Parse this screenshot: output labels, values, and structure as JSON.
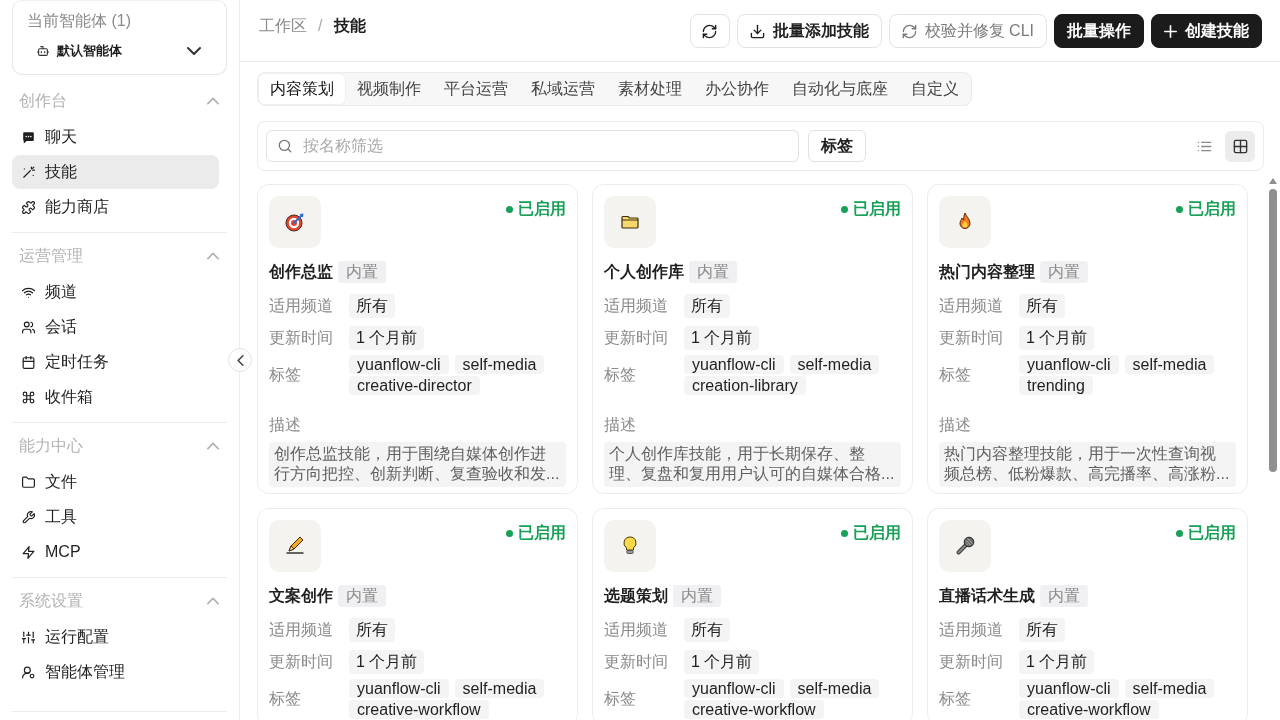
{
  "sidebar": {
    "agent": {
      "label": "当前智能体 (1)",
      "value": "默认智能体"
    },
    "sections": [
      {
        "title": "创作台",
        "expanded": true,
        "items": [
          {
            "label": "聊天",
            "selected": false
          },
          {
            "label": "技能",
            "selected": true
          },
          {
            "label": "能力商店",
            "selected": false
          }
        ]
      },
      {
        "title": "运营管理",
        "expanded": true,
        "items": [
          {
            "label": "频道",
            "selected": false
          },
          {
            "label": "会话",
            "selected": false
          },
          {
            "label": "定时任务",
            "selected": false
          },
          {
            "label": "收件箱",
            "selected": false
          }
        ]
      },
      {
        "title": "能力中心",
        "expanded": true,
        "items": [
          {
            "label": "文件",
            "selected": false
          },
          {
            "label": "工具",
            "selected": false
          },
          {
            "label": "MCP",
            "selected": false
          }
        ]
      },
      {
        "title": "系统设置",
        "expanded": true,
        "items": [
          {
            "label": "运行配置",
            "selected": false
          },
          {
            "label": "智能体管理",
            "selected": false
          }
        ]
      }
    ]
  },
  "header": {
    "breadcrumb": {
      "items": [
        "工作区",
        "技能"
      ],
      "separator": "/"
    },
    "buttons": [
      {
        "kind": "icon",
        "disabled": false
      },
      {
        "kind": "outline",
        "label": "批量添加技能",
        "disabled": false
      },
      {
        "kind": "outline",
        "label": "校验并修复 CLI",
        "disabled": true
      },
      {
        "kind": "primary",
        "label": "批量操作",
        "disabled": false
      },
      {
        "kind": "primary",
        "label": "创建技能",
        "disabled": false
      }
    ]
  },
  "tabs": [
    {
      "label": "内容策划",
      "selected": true
    },
    {
      "label": "视频制作",
      "selected": false
    },
    {
      "label": "平台运营",
      "selected": false
    },
    {
      "label": "私域运营",
      "selected": false
    },
    {
      "label": "素材处理",
      "selected": false
    },
    {
      "label": "办公协作",
      "selected": false
    },
    {
      "label": "自动化与底座",
      "selected": false
    },
    {
      "label": "自定义",
      "selected": false
    }
  ],
  "filter": {
    "search": {
      "placeholder": "按名称筛选"
    },
    "tag_button": "标签",
    "views": [
      {
        "selected": false
      },
      {
        "selected": true
      }
    ]
  },
  "cards": [
    {
      "name": "创作总监",
      "badge": "内置",
      "status": {
        "text": "已启用",
        "enabled": true
      },
      "channels": {
        "label": "适用频道",
        "value": "所有"
      },
      "updated": {
        "label": "更新时间",
        "value": "1 个月前"
      },
      "tags": {
        "label": "标签",
        "items": [
          "yuanflow-cli",
          "self-media",
          "creative-director"
        ]
      },
      "description": {
        "label": "描述",
        "text": "创作总监技能，用于围绕自媒体创作进行方向把控、创新判断、复查验收和发..."
      }
    },
    {
      "name": "个人创作库",
      "badge": "内置",
      "status": {
        "text": "已启用",
        "enabled": true
      },
      "channels": {
        "label": "适用频道",
        "value": "所有"
      },
      "updated": {
        "label": "更新时间",
        "value": "1 个月前"
      },
      "tags": {
        "label": "标签",
        "items": [
          "yuanflow-cli",
          "self-media",
          "creation-library"
        ]
      },
      "description": {
        "label": "描述",
        "text": "个人创作库技能，用于长期保存、整理、复盘和复用用户认可的自媒体合格..."
      }
    },
    {
      "name": "热门内容整理",
      "badge": "内置",
      "status": {
        "text": "已启用",
        "enabled": true
      },
      "channels": {
        "label": "适用频道",
        "value": "所有"
      },
      "updated": {
        "label": "更新时间",
        "value": "1 个月前"
      },
      "tags": {
        "label": "标签",
        "items": [
          "yuanflow-cli",
          "self-media",
          "trending"
        ]
      },
      "description": {
        "label": "描述",
        "text": "热门内容整理技能，用于一次性查询视频总榜、低粉爆款、高完播率、高涨粉..."
      }
    },
    {
      "name": "文案创作",
      "badge": "内置",
      "status": {
        "text": "已启用",
        "enabled": true
      },
      "channels": {
        "label": "适用频道",
        "value": "所有"
      },
      "updated": {
        "label": "更新时间",
        "value": "1 个月前"
      },
      "tags": {
        "label": "标签",
        "items": [
          "yuanflow-cli",
          "self-media",
          "creative-workflow"
        ]
      }
    },
    {
      "name": "选题策划",
      "badge": "内置",
      "status": {
        "text": "已启用",
        "enabled": true
      },
      "channels": {
        "label": "适用频道",
        "value": "所有"
      },
      "updated": {
        "label": "更新时间",
        "value": "1 个月前"
      },
      "tags": {
        "label": "标签",
        "items": [
          "yuanflow-cli",
          "self-media",
          "creative-workflow"
        ]
      }
    },
    {
      "name": "直播话术生成",
      "badge": "内置",
      "status": {
        "text": "已启用",
        "enabled": true
      },
      "channels": {
        "label": "适用频道",
        "value": "所有"
      },
      "updated": {
        "label": "更新时间",
        "value": "1 个月前"
      },
      "tags": {
        "label": "标签",
        "items": [
          "yuanflow-cli",
          "self-media",
          "creative-workflow"
        ]
      }
    }
  ]
}
